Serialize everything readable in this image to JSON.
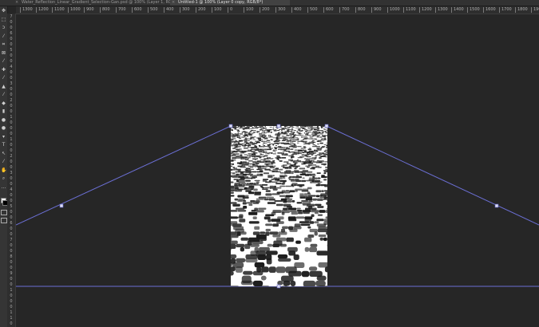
{
  "tabs": [
    {
      "label": "Water_Reflection_Linear_Gradient_Selection-Gan.psd @ 100% (Layer 1, RGB/8*)",
      "active": false
    },
    {
      "label": "Untitled-1 @ 100% (Layer 0 copy, RGB/8*)",
      "active": true
    }
  ],
  "ruler_horizontal": [
    "1300",
    "1200",
    "1100",
    "1000",
    "900",
    "800",
    "700",
    "600",
    "500",
    "400",
    "300",
    "200",
    "100",
    "0",
    "100",
    "200",
    "300",
    "400",
    "500",
    "600",
    "700",
    "800",
    "900",
    "1000",
    "1100",
    "1200",
    "1300",
    "1400",
    "1500",
    "1600",
    "1700",
    "1800",
    "1900"
  ],
  "ruler_vertical": [
    "7",
    "0",
    "0",
    "6",
    "0",
    "0",
    "5",
    "0",
    "0",
    "4",
    "0",
    "0",
    "3",
    "0",
    "0",
    "2",
    "0",
    "0",
    "1",
    "0",
    "0",
    "0",
    "1",
    "0",
    "0",
    "2",
    "0",
    "0",
    "3",
    "0",
    "0",
    "4",
    "0",
    "0",
    "5",
    "0",
    "0",
    "6",
    "0",
    "0",
    "7",
    "0",
    "0",
    "8",
    "0",
    "0",
    "9",
    "0",
    "0",
    "1",
    "0",
    "0",
    "0",
    "1",
    "1",
    "0"
  ],
  "tools": [
    {
      "name": "move-tool-icon",
      "glyph": "✥"
    },
    {
      "name": "marquee-tool-icon",
      "glyph": "⬚"
    },
    {
      "name": "lasso-tool-icon",
      "glyph": "ↄ"
    },
    {
      "name": "quick-selection-tool-icon",
      "glyph": "⁄"
    },
    {
      "name": "crop-tool-icon",
      "glyph": "⌗"
    },
    {
      "name": "frame-tool-icon",
      "glyph": "⊠"
    },
    {
      "name": "eyedropper-tool-icon",
      "glyph": "⁄"
    },
    {
      "name": "healing-brush-tool-icon",
      "glyph": "✚"
    },
    {
      "name": "brush-tool-icon",
      "glyph": "⁄"
    },
    {
      "name": "clone-stamp-tool-icon",
      "glyph": "▲"
    },
    {
      "name": "history-brush-tool-icon",
      "glyph": "⁄"
    },
    {
      "name": "eraser-tool-icon",
      "glyph": "◆"
    },
    {
      "name": "gradient-tool-icon",
      "glyph": "▮"
    },
    {
      "name": "blur-tool-icon",
      "glyph": "●"
    },
    {
      "name": "dodge-tool-icon",
      "glyph": "●"
    },
    {
      "name": "pen-tool-icon",
      "glyph": "▾"
    },
    {
      "name": "type-tool-icon",
      "glyph": "T"
    },
    {
      "name": "path-selection-tool-icon",
      "glyph": "↖"
    },
    {
      "name": "line-tool-icon",
      "glyph": "⁄"
    },
    {
      "name": "hand-tool-icon",
      "glyph": "✋"
    },
    {
      "name": "zoom-tool-icon",
      "glyph": "⌕"
    },
    {
      "name": "more-tools-icon",
      "glyph": "…"
    }
  ],
  "colors": {
    "background": "#262626",
    "guide_line": "#6b6fd4",
    "handle": "#dcdcf0",
    "pattern_dark": "#1a1a1a",
    "pattern_light": "#ffffff"
  }
}
